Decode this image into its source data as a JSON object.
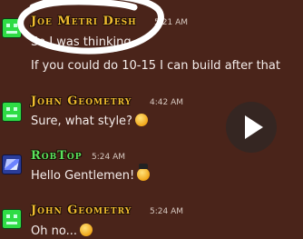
{
  "messages": [
    {
      "author": "Joe Metri Desh",
      "time": "5:21 AM",
      "lines": [
        "So I was thinking",
        "If you could do 10-15 I can build after that"
      ]
    },
    {
      "author": "John Geometry",
      "time": "4:42 AM",
      "text": "Sure, what style?",
      "emoji": "thinking-face"
    },
    {
      "author": "RobTop",
      "time": "5:24 AM",
      "text": "Hello Gentlemen!",
      "emoji": "face-with-top-hat"
    },
    {
      "author": "John Geometry",
      "time": "5:24 AM",
      "text": "Oh no...",
      "emoji": "hand-over-face"
    }
  ],
  "overlay": {
    "icon": "play-icon"
  },
  "colors": {
    "background": "#4a241a",
    "name_gold": "#f0bd2f",
    "name_green": "#59e35c",
    "text": "#f4ecea"
  }
}
